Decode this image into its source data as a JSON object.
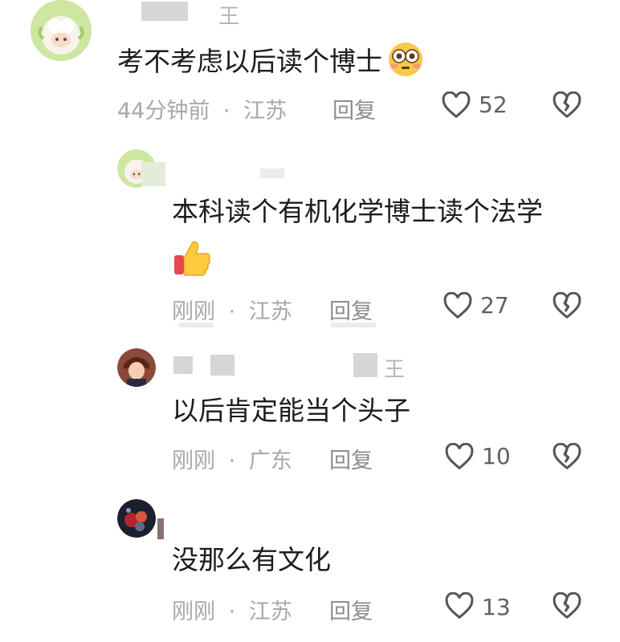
{
  "comments": [
    {
      "author": "王",
      "text": "考不考虑以后读个博士",
      "emoji": "flushed-face-icon",
      "time": "44分钟前",
      "location": "江苏",
      "reply_label": "回复",
      "likes": "52"
    },
    {
      "author": "",
      "text_line1": "本科读个有机化学博士读个法学",
      "emoji": "thumbs-up-icon",
      "time": "刚刚",
      "location": "江苏",
      "reply_label": "回复",
      "likes": "27"
    },
    {
      "author": "王",
      "text": "以后肯定能当个头子",
      "time": "刚刚",
      "location": "广东",
      "reply_label": "回复",
      "likes": "10"
    },
    {
      "author": "",
      "text": "没那么有文化",
      "time": "刚刚",
      "location": "江苏",
      "reply_label": "回复",
      "likes": "13"
    }
  ],
  "separator": "·",
  "colors": {
    "text": "#1c1c1c",
    "meta": "#a8a8a8",
    "reply": "#8c8c8c",
    "icon": "#555555"
  }
}
